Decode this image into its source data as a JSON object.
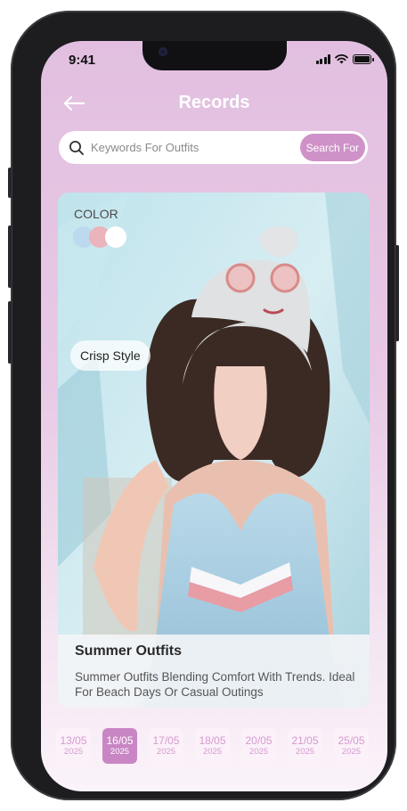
{
  "status_bar": {
    "time": "9:41"
  },
  "header": {
    "title": "Records",
    "back_icon": "arrow-left-icon"
  },
  "search": {
    "placeholder": "Keywords For Outfits",
    "value": "",
    "button_label": "Search For",
    "icon": "search-icon"
  },
  "card": {
    "color_label": "COLOR",
    "swatches": [
      "#bcd9ee",
      "#ebb3bb",
      "#ffffff"
    ],
    "style_tag": "Crisp Style",
    "title": "Summer Outfits",
    "description": "Summer Outfits Blending Comfort With Trends. Ideal For Beach Days Or Casual Outings"
  },
  "dates": [
    {
      "day": "13/05",
      "year": "2025",
      "active": false
    },
    {
      "day": "16/05",
      "year": "2025",
      "active": true
    },
    {
      "day": "17/05",
      "year": "2025",
      "active": false
    },
    {
      "day": "18/05",
      "year": "2025",
      "active": false
    },
    {
      "day": "20/05",
      "year": "2025",
      "active": false
    },
    {
      "day": "21/05",
      "year": "2025",
      "active": false
    },
    {
      "day": "25/05",
      "year": "2025",
      "active": false
    }
  ],
  "colors": {
    "accent": "#cf92c8",
    "active_date": "#c986c4",
    "date_text": "#d59ad0"
  }
}
